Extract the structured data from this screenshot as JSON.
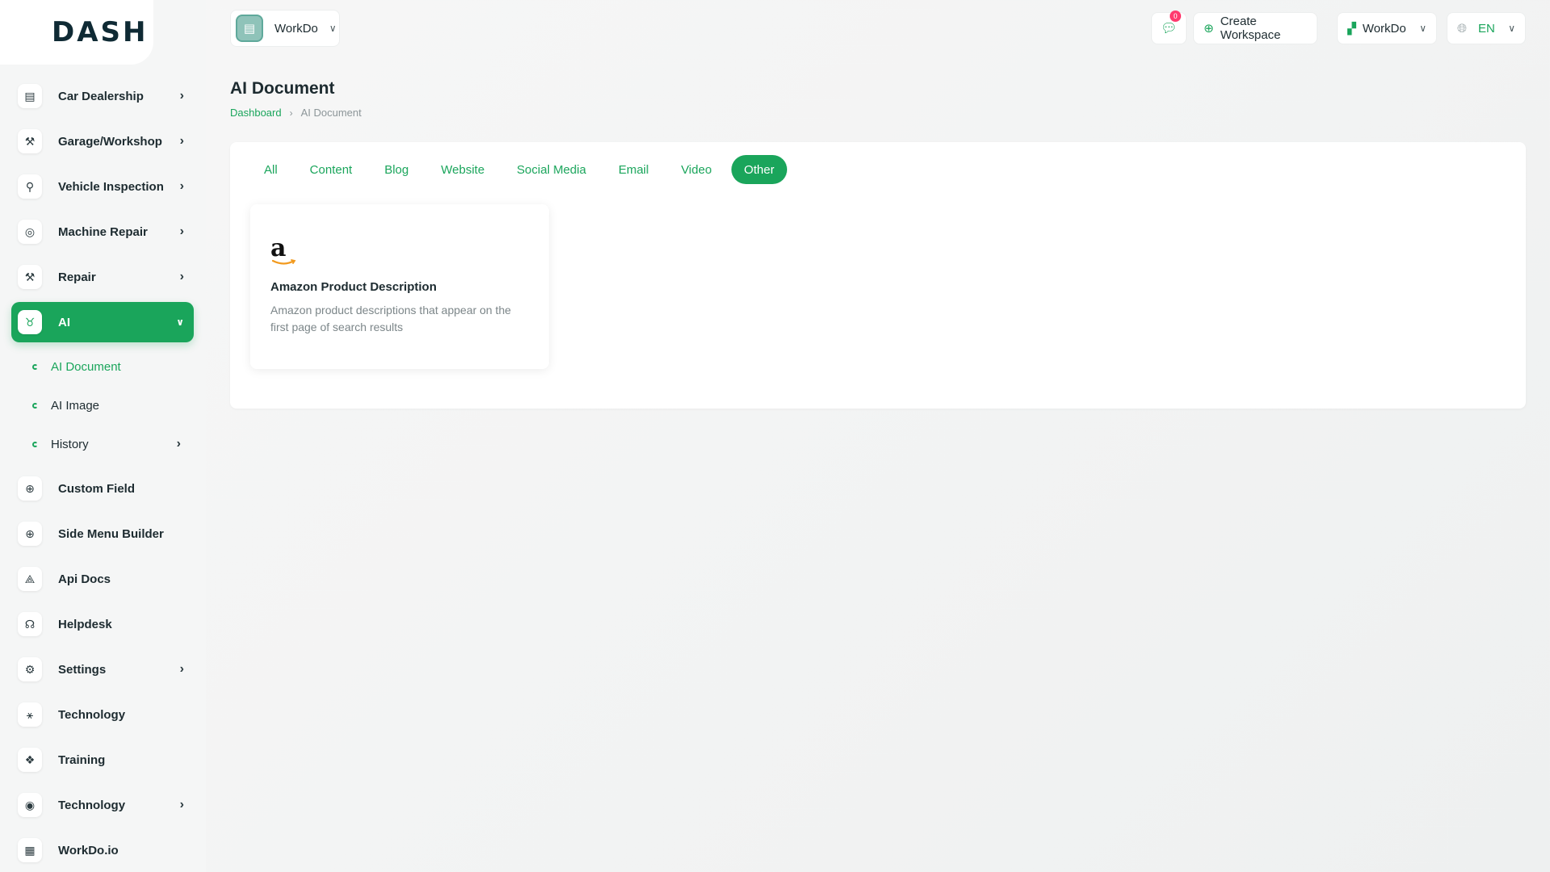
{
  "brand": {
    "logo_text": "DASH",
    "accent": "#1aa55b"
  },
  "sidebar": {
    "items": [
      {
        "label": "Car Dealership",
        "icon": "car-dealership-icon",
        "has_arrow": true
      },
      {
        "label": "Garage/Workshop",
        "icon": "wrench-icon",
        "has_arrow": true
      },
      {
        "label": "Vehicle Inspection",
        "icon": "motorbike-icon",
        "has_arrow": true
      },
      {
        "label": "Machine Repair",
        "icon": "machine-icon",
        "has_arrow": true
      },
      {
        "label": "Repair",
        "icon": "tools-icon",
        "has_arrow": true
      },
      {
        "label": "AI",
        "icon": "ai-icon",
        "active": true,
        "expanded": true
      }
    ],
    "ai_submenu": [
      {
        "label": "AI Document",
        "current": true
      },
      {
        "label": "AI Image"
      },
      {
        "label": "History",
        "has_arrow": true
      }
    ],
    "items_after": [
      {
        "label": "Custom Field",
        "icon": "plus-circle-icon"
      },
      {
        "label": "Side Menu Builder",
        "icon": "plus-circle-icon"
      },
      {
        "label": "Api Docs",
        "icon": "api-icon"
      },
      {
        "label": "Helpdesk",
        "icon": "headset-icon"
      },
      {
        "label": "Settings",
        "icon": "gear-icon",
        "has_arrow": true
      },
      {
        "label": "Technology",
        "icon": "network-icon"
      },
      {
        "label": "Training",
        "icon": "training-icon"
      },
      {
        "label": "Technology",
        "icon": "broadcast-icon",
        "has_arrow": true
      },
      {
        "label": "WorkDo.io",
        "icon": "document-icon"
      }
    ]
  },
  "header": {
    "workspace_name": "WorkDo",
    "chat_badge": "0",
    "create_workspace": "Create Workspace",
    "user_menu": "WorkDo",
    "language": "EN"
  },
  "page": {
    "title": "AI Document",
    "breadcrumb": {
      "home": "Dashboard",
      "current": "AI Document"
    }
  },
  "tabs": [
    "All",
    "Content",
    "Blog",
    "Website",
    "Social Media",
    "Email",
    "Video",
    "Other"
  ],
  "active_tab": "Other",
  "documents": [
    {
      "logo": "a",
      "title": "Amazon Product Description",
      "description": "Amazon product descriptions that appear on the first page of search results"
    }
  ]
}
